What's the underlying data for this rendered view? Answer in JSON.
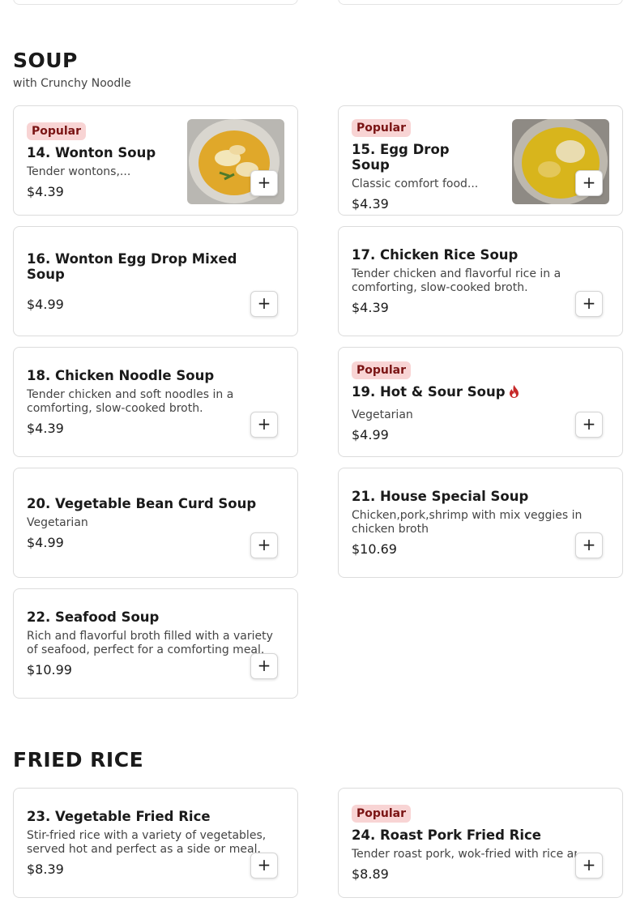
{
  "soup": {
    "title": "SOUP",
    "subtitle": "with Crunchy Noodle",
    "items": [
      {
        "badge": "Popular",
        "name": "14. Wonton Soup",
        "desc": "Tender wontons,...",
        "price": "$4.39"
      },
      {
        "badge": "Popular",
        "name": "15. Egg Drop Soup",
        "desc": "Classic comfort food...",
        "price": "$4.39"
      },
      {
        "name": "16. Wonton Egg Drop Mixed Soup",
        "price": "$4.99"
      },
      {
        "name": "17. Chicken Rice Soup",
        "desc": "Tender chicken and flavorful rice in a comforting, slow-cooked broth.",
        "price": "$4.39"
      },
      {
        "name": "18. Chicken Noodle Soup",
        "desc": "Tender chicken and soft noodles in a comforting, slow-cooked broth.",
        "price": "$4.39"
      },
      {
        "badge": "Popular",
        "name": "19. Hot & Sour Soup",
        "desc": "Vegetarian",
        "price": "$4.99",
        "icon": "spicy-flame-icon"
      },
      {
        "name": "20. Vegetable Bean Curd Soup",
        "desc": "Vegetarian",
        "price": "$4.99"
      },
      {
        "name": "21. House Special Soup",
        "desc": "Chicken,pork,shrimp with mix veggies in chicken broth",
        "price": "$10.69"
      },
      {
        "name": "22. Seafood Soup",
        "desc": "Rich and flavorful broth filled with a variety of seafood, perfect for a comforting meal.",
        "price": "$10.99"
      }
    ]
  },
  "fried_rice": {
    "title": "FRIED RICE",
    "items": [
      {
        "name": "23. Vegetable Fried Rice",
        "desc": "Stir-fried rice with a variety of vegetables, served hot and perfect as a side or meal.",
        "price": "$8.39"
      },
      {
        "badge": "Popular",
        "name": "24. Roast Pork Fried Rice",
        "desc": "Tender roast pork, wok-fried with rice and",
        "price": "$8.89"
      }
    ]
  },
  "add_label": "+",
  "colors": {
    "badge_bg": "#f8d4d4",
    "badge_text": "#7a1414",
    "flame": "#c62828"
  }
}
